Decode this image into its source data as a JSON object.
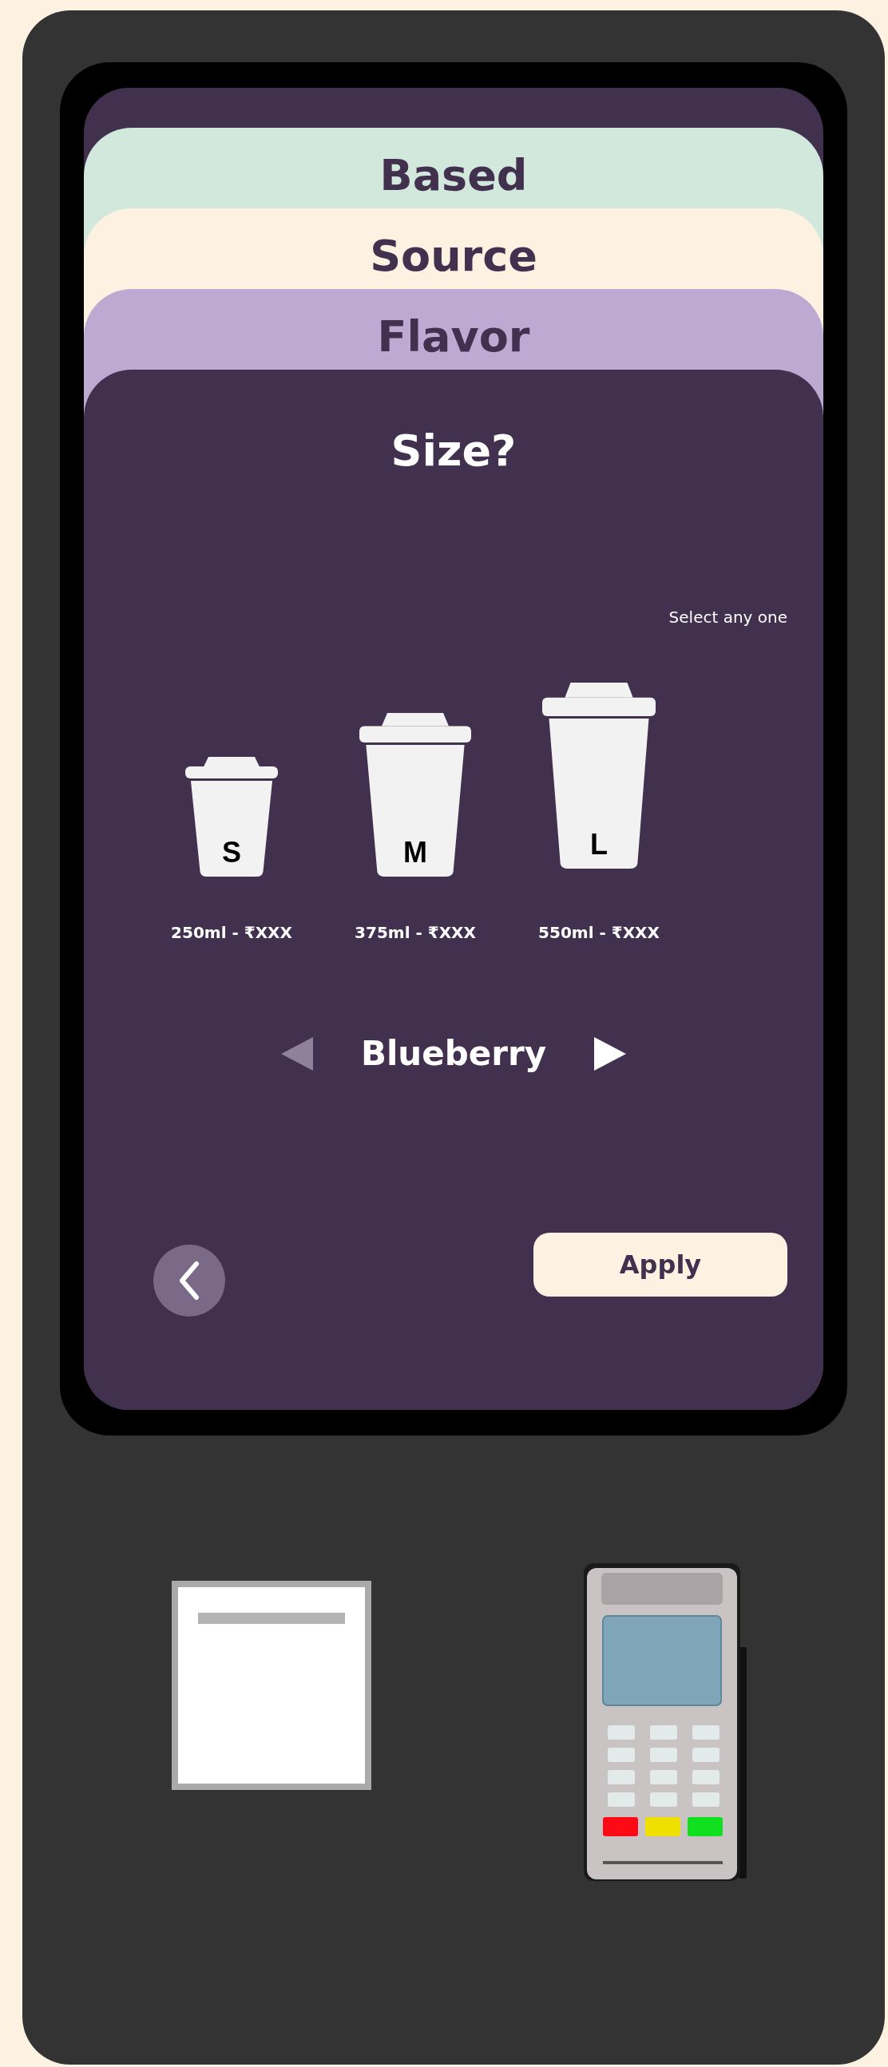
{
  "steps": [
    {
      "label": "Based",
      "color": "#d3e8dd"
    },
    {
      "label": "Source",
      "color": "#fdf1e2"
    },
    {
      "label": "Flavor",
      "color": "#bcaad2"
    }
  ],
  "panel": {
    "title": "Size?",
    "hint": "Select any one",
    "sizes": [
      {
        "letter": "S",
        "label": "250ml - ₹XXX"
      },
      {
        "letter": "M",
        "label": "375ml - ₹XXX"
      },
      {
        "letter": "L",
        "label": "550ml - ₹XXX"
      }
    ],
    "flavor": {
      "value": "Blueberry",
      "prev_disabled": true,
      "next_disabled": false
    },
    "apply": "Apply"
  }
}
